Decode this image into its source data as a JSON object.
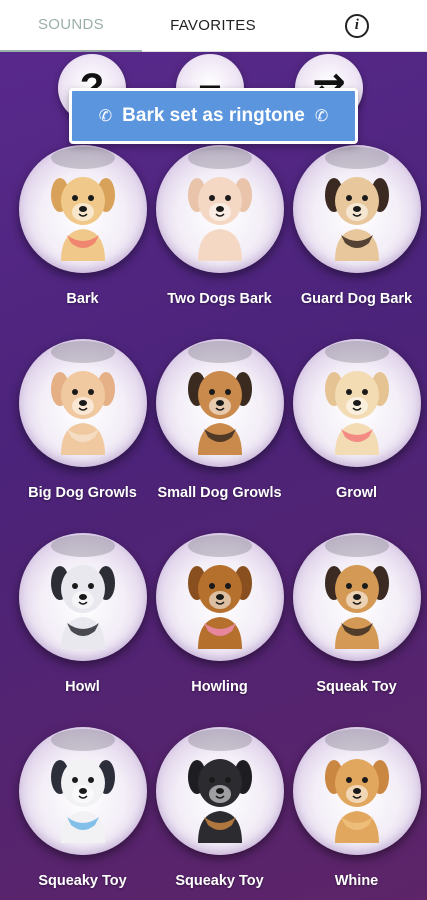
{
  "tabs": {
    "sounds": "SOUNDS",
    "favorites": "FAVORITES",
    "info": "i"
  },
  "top_buttons": [
    {
      "icon": "question-icon",
      "glyph": "?"
    },
    {
      "icon": "minus-icon",
      "glyph": "−"
    },
    {
      "icon": "shuffle-icon",
      "glyph": "⇄"
    }
  ],
  "toast": {
    "text": "Bark set as ringtone",
    "icon": "phone-ring-icon"
  },
  "sounds": [
    {
      "label": "Bark",
      "dog": "golden-with-bandana",
      "fur": "#f0c98a",
      "ear": "#d9a25a",
      "accent": "#f07a6a"
    },
    {
      "label": "Two Dogs Bark",
      "dog": "poodle",
      "fur": "#f4d8c4",
      "ear": "#e9c3aa",
      "accent": "#f4d8c4"
    },
    {
      "label": "Guard Dog Bark",
      "dog": "pug",
      "fur": "#e8c79c",
      "ear": "#3a2a22",
      "accent": "#3a2a22"
    },
    {
      "label": "Big Dog Growls",
      "dog": "chihuahua",
      "fur": "#f1c9a0",
      "ear": "#e5b085",
      "accent": "#f5e0c8"
    },
    {
      "label": "Small Dog Growls",
      "dog": "german-shepherd",
      "fur": "#c98a4b",
      "ear": "#3b2a20",
      "accent": "#3b2a20"
    },
    {
      "label": "Growl",
      "dog": "labrador",
      "fur": "#f3dcb4",
      "ear": "#e6c392",
      "accent": "#f27b7b"
    },
    {
      "label": "Howl",
      "dog": "borzoi",
      "fur": "#e8e8ee",
      "ear": "#2d2d35",
      "accent": "#2d2d35"
    },
    {
      "label": "Howling",
      "dog": "yorkie",
      "fur": "#b5702e",
      "ear": "#8a4f1e",
      "accent": "#f089b0"
    },
    {
      "label": "Squeak Toy",
      "dog": "mastiff",
      "fur": "#d49a55",
      "ear": "#3a2a22",
      "accent": "#3a2a22"
    },
    {
      "label": "Squeaky Toy",
      "dog": "husky",
      "fur": "#f2f2f5",
      "ear": "#2c2f3a",
      "accent": "#6fb7e8"
    },
    {
      "label": "Squeaky Toy",
      "dog": "rottweiler",
      "fur": "#2b2b30",
      "ear": "#1d1d22",
      "accent": "#c7843f"
    },
    {
      "label": "Whine",
      "dog": "cocker-spaniel",
      "fur": "#e2a75e",
      "ear": "#c98742",
      "accent": "#f0c17f"
    }
  ]
}
